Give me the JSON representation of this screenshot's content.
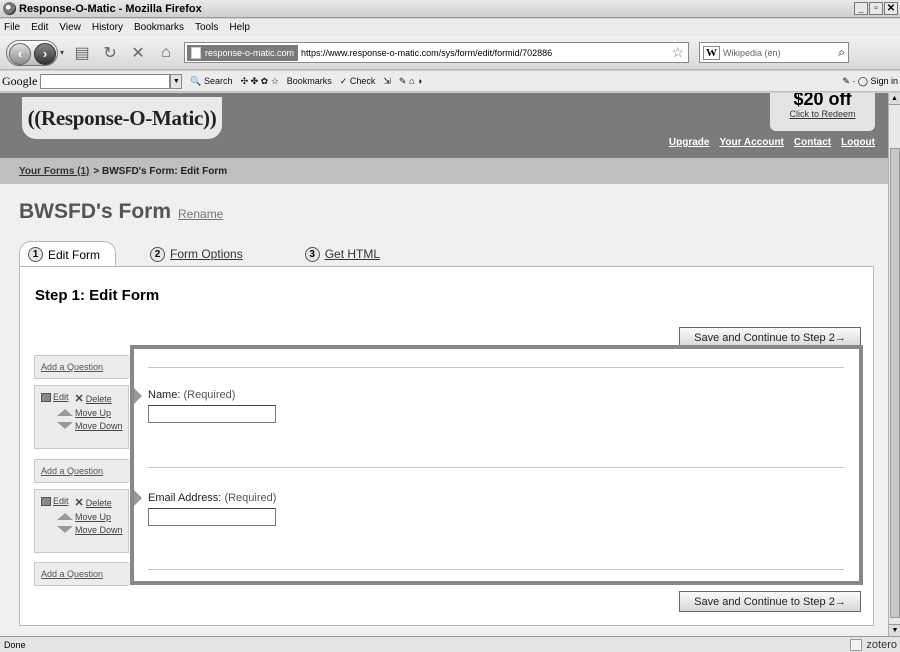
{
  "window": {
    "title": "Response-O-Matic - Mozilla Firefox"
  },
  "menu": [
    "File",
    "Edit",
    "View",
    "History",
    "Bookmarks",
    "Tools",
    "Help"
  ],
  "nav": {
    "site_badge": "response-o-matic.com",
    "url": "https://www.response-o-matic.com/sys/form/edit/formid/702886",
    "search_engine": "W",
    "search_placeholder": "Wikipedia (en)"
  },
  "google_bar": {
    "logo": "Google",
    "search_label": "Search",
    "bookmarks_label": "Bookmarks",
    "check_label": "Check",
    "sign_in": "Sign in"
  },
  "header": {
    "logo_text": "((Response-O-Matic))",
    "promo_amount": "$20 off",
    "promo_link": "Click to Redeem",
    "links": [
      "Upgrade",
      "Your Account",
      "Contact",
      "Logout"
    ]
  },
  "breadcrumb": {
    "link": "Your Forms (1)",
    "rest": "> BWSFD's Form: Edit Form"
  },
  "form_title": {
    "name": "BWSFD's Form",
    "rename": "Rename"
  },
  "tabs": [
    {
      "num": "1",
      "label": "Edit Form"
    },
    {
      "num": "2",
      "label": "Form Options"
    },
    {
      "num": "3",
      "label": "Get HTML"
    }
  ],
  "step_title": "Step 1: Edit Form",
  "save_label": "Save and Continue to Step 2→",
  "sidebar": {
    "add_question": "Add a Question",
    "edit": "Edit",
    "delete": "Delete",
    "move_up": "Move Up",
    "move_down": "Move Down"
  },
  "fields": [
    {
      "label": "Name:",
      "req": "(Required)"
    },
    {
      "label": "Email Address:",
      "req": "(Required)"
    }
  ],
  "status": {
    "text": "Done",
    "addon": "zotero"
  }
}
